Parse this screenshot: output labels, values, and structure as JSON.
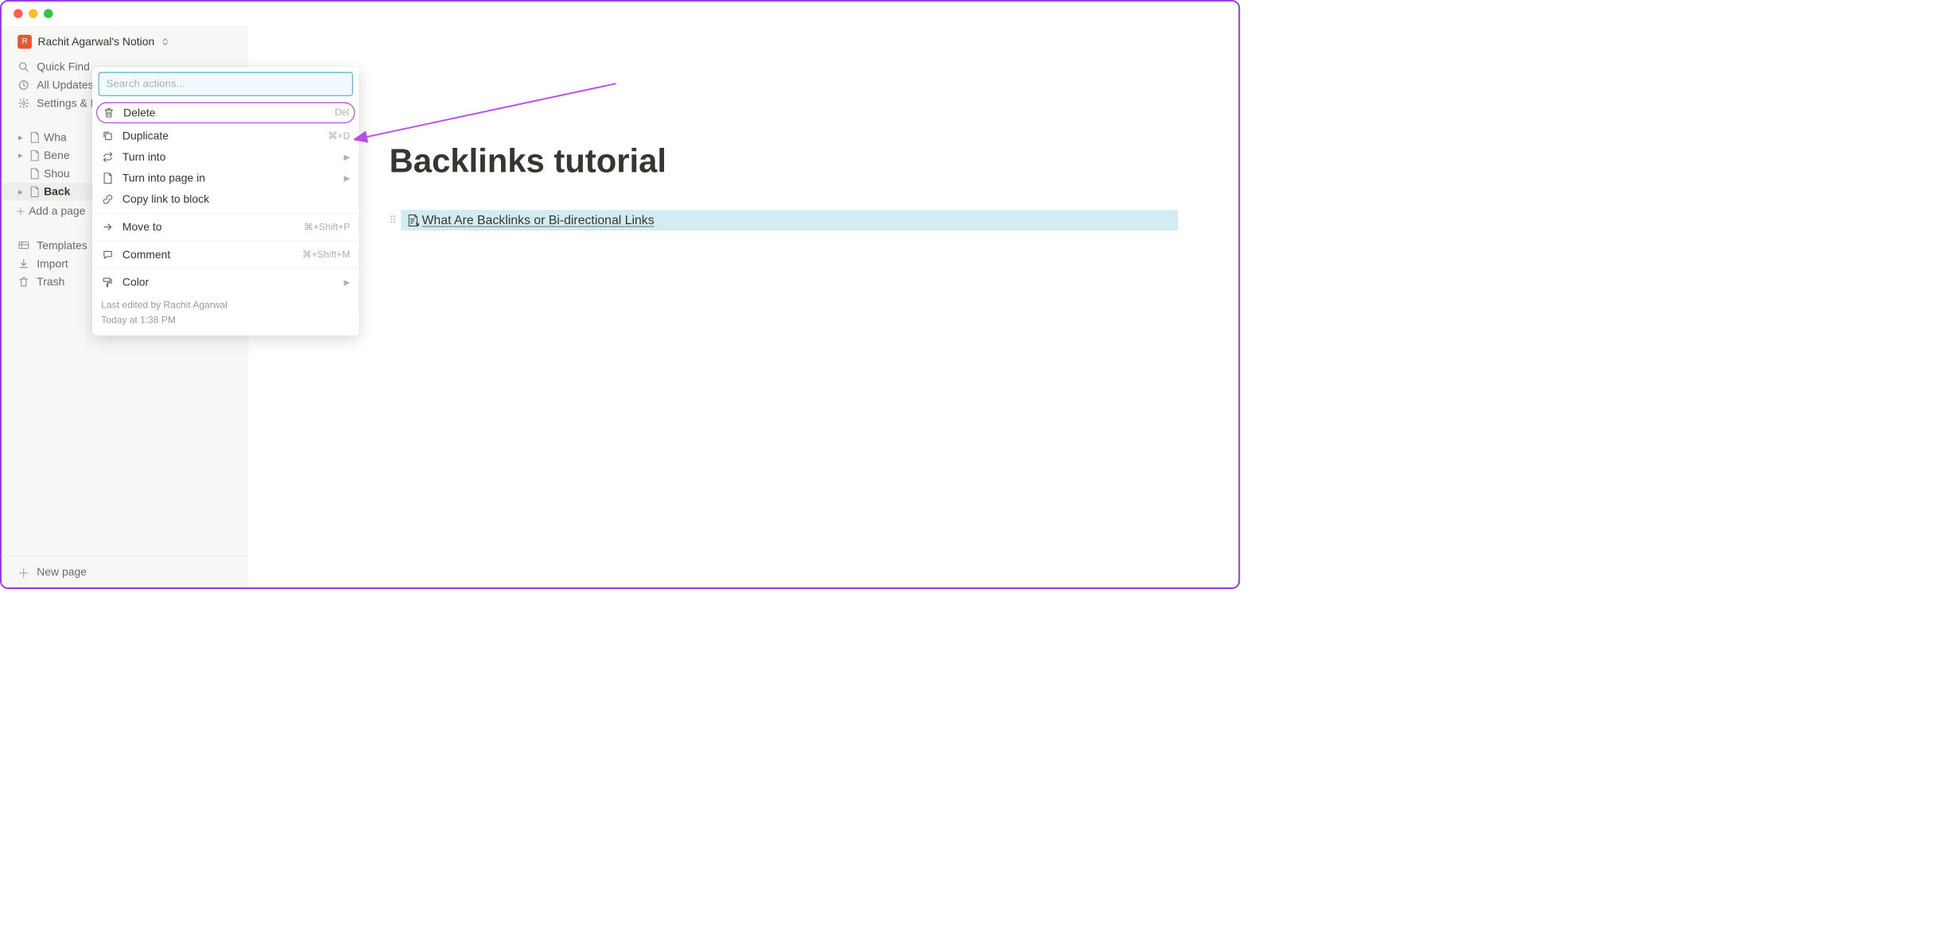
{
  "workspace": {
    "avatar_letter": "R",
    "name": "Rachit Agarwal's Notion"
  },
  "sidebar": {
    "quick_find": "Quick Find",
    "all_updates": "All Updates",
    "settings": "Settings & Members",
    "pages": [
      {
        "label": "What Are Backlinks or Bi-directional Links",
        "active": false,
        "truncated": "Wha"
      },
      {
        "label": "Benefits of Backlinks",
        "active": false,
        "truncated": "Bene"
      },
      {
        "label": "Should You Use Backlinks",
        "active": false,
        "truncated": "Shou",
        "no_triangle": true
      },
      {
        "label": "Backlinks tutorial",
        "active": true,
        "truncated": "Back"
      }
    ],
    "add_page": "Add a page",
    "templates": "Templates",
    "import": "Import",
    "trash": "Trash",
    "new_page": "New page"
  },
  "context_menu": {
    "search_placeholder": "Search actions...",
    "items": {
      "delete": {
        "label": "Delete",
        "shortcut": "Del"
      },
      "duplicate": {
        "label": "Duplicate",
        "shortcut": "⌘+D"
      },
      "turn_into": {
        "label": "Turn into"
      },
      "turn_into_page": {
        "label": "Turn into page in"
      },
      "copy_link": {
        "label": "Copy link to block"
      },
      "move_to": {
        "label": "Move to",
        "shortcut": "⌘+Shift+P"
      },
      "comment": {
        "label": "Comment",
        "shortcut": "⌘+Shift+M"
      },
      "color": {
        "label": "Color"
      }
    },
    "footer_line1": "Last edited by Rachit Agarwal",
    "footer_line2": "Today at 1:38 PM"
  },
  "main": {
    "title": "Backlinks tutorial",
    "linked_block": "What Are Backlinks or Bi-directional Links"
  }
}
